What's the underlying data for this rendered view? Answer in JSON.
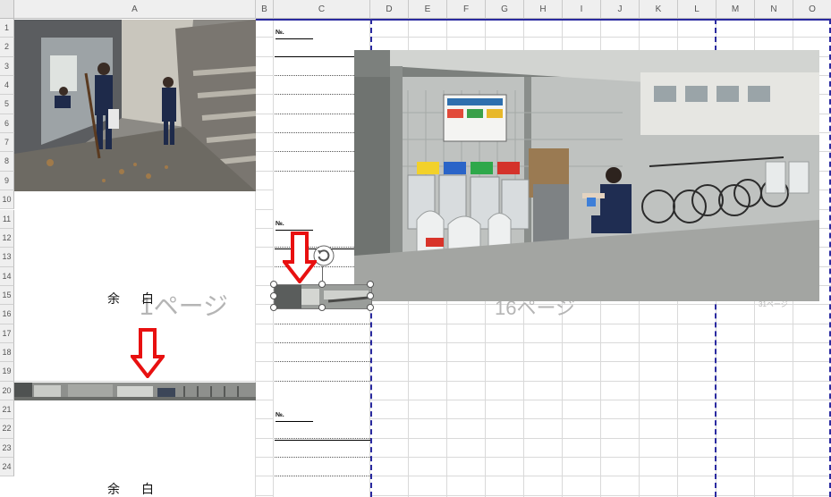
{
  "columns": [
    "A",
    "B",
    "C",
    "D",
    "E",
    "F",
    "G",
    "H",
    "I",
    "J",
    "K",
    "L",
    "M",
    "N",
    "O"
  ],
  "rows": [
    "1",
    "2",
    "3",
    "4",
    "5",
    "6",
    "7",
    "8",
    "9",
    "10",
    "11",
    "12",
    "13",
    "14",
    "15",
    "16",
    "17",
    "18",
    "19",
    "20",
    "21",
    "22",
    "23",
    "24"
  ],
  "form": {
    "no_label_1": "№.",
    "no_label_2": "№.",
    "no_label_3": "№.",
    "margin_text_1": "余白",
    "margin_text_2": "余白"
  },
  "page_watermarks": {
    "page1": "1ページ",
    "page16": "16ページ",
    "page31": "31ページ"
  },
  "images": {
    "top_left": "corridor-cleaning-photo",
    "large": "garbage-station-cleaning-photo",
    "selected_small": "selected-thumbnail-image",
    "strip": "panorama-strip-image"
  },
  "colors": {
    "page_break": "#2a2aa0",
    "arrow": "#e81010",
    "header_bg": "#efefef"
  }
}
